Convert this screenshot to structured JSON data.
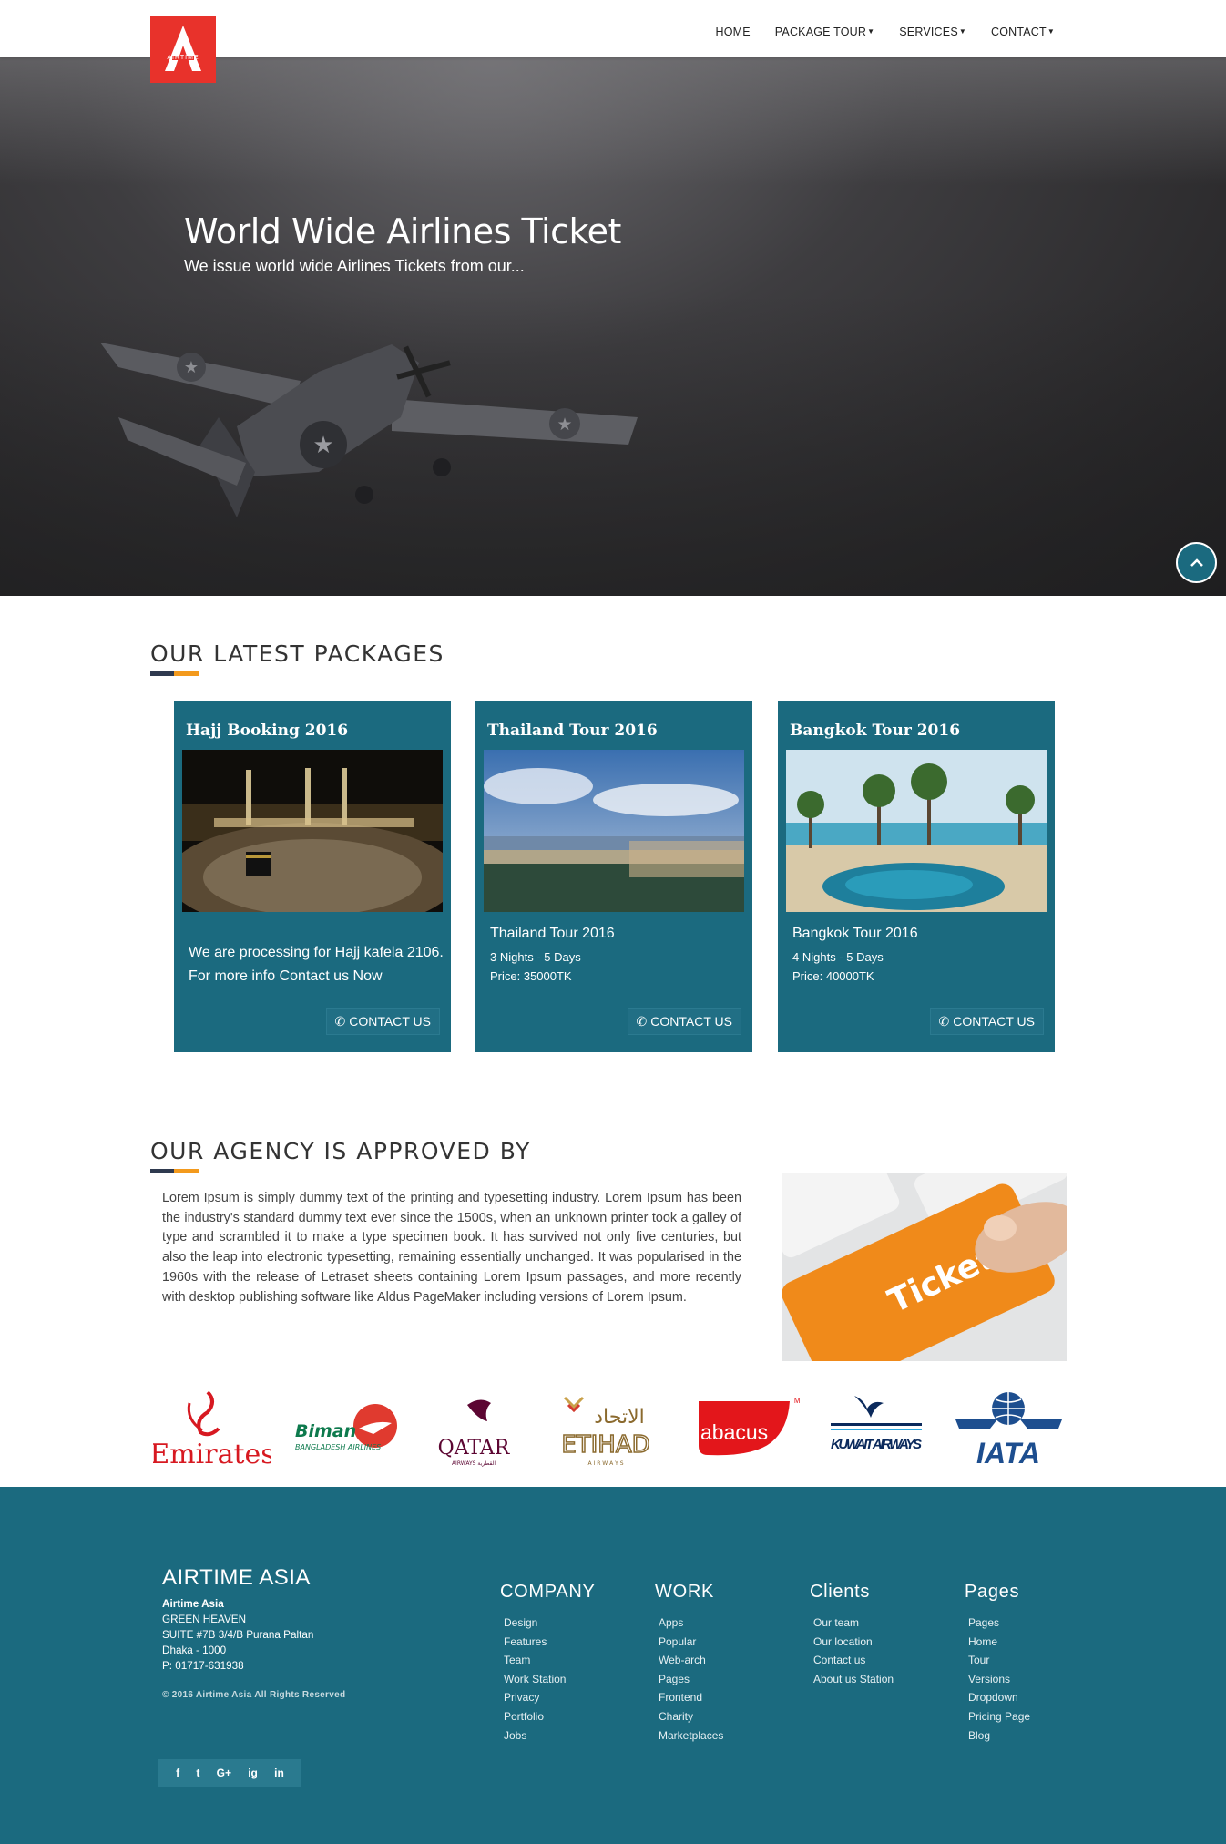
{
  "nav": {
    "brand": "AIRTIME",
    "items": [
      {
        "label": "HOME",
        "dropdown": false
      },
      {
        "label": "PACKAGE TOUR",
        "dropdown": true
      },
      {
        "label": "SERVICES",
        "dropdown": true
      },
      {
        "label": "CONTACT",
        "dropdown": true
      }
    ]
  },
  "hero": {
    "title": "World Wide Airlines Ticket",
    "subtitle": "We issue world wide Airlines Tickets from our..."
  },
  "packages_section": {
    "title": "OUR LATEST PACKAGES",
    "cards": [
      {
        "title": "Hajj Booking 2016",
        "text_line1": "We are processing for Hajj kafela 2106.",
        "text_line2": "For more info Contact us Now",
        "button": "CONTACT US"
      },
      {
        "title": "Thailand Tour 2016",
        "name": "Thailand Tour 2016",
        "duration": "3 Nights - 5 Days",
        "price": "Price: 35000TK",
        "button": "CONTACT US"
      },
      {
        "title": "Bangkok Tour 2016",
        "name": "Bangkok Tour 2016",
        "duration": "4 Nights - 5 Days",
        "price": "Price: 40000TK",
        "button": "CONTACT US"
      }
    ]
  },
  "approved_section": {
    "title": "OUR AGENCY IS APPROVED BY",
    "body": "Lorem Ipsum is simply dummy text of the printing and typesetting industry. Lorem Ipsum has been the industry's standard dummy text ever since the 1500s, when an unknown printer took a galley of type and scrambled it to make a type specimen book. It has survived not only five centuries, but also the leap into electronic typesetting, remaining essentially unchanged. It was popularised in the 1960s with the release of Letraset sheets containing Lorem Ipsum passages, and more recently with desktop publishing software like Aldus PageMaker including versions of Lorem Ipsum.",
    "image_label": "Ticket"
  },
  "partner_logos": [
    {
      "name": "Emirates",
      "color": "#d71921"
    },
    {
      "name": "Biman",
      "sub": "BANGLADESH AIRLINES",
      "color": "#e03a2f"
    },
    {
      "name": "QATAR",
      "sub": "AIRWAYS القطرية",
      "color": "#5c0632"
    },
    {
      "name": "ETIHAD",
      "sub": "A I R W A Y S",
      "arabic": "الاتحاد",
      "color": "#8b6a2e"
    },
    {
      "name": "abacus",
      "tm": "TM",
      "color": "#e3161b"
    },
    {
      "name": "KUWAIT AIRWAYS",
      "color": "#0b2a5c"
    },
    {
      "name": "IATA",
      "color": "#1d4e8f"
    }
  ],
  "footer": {
    "brand": "AIRTIME ASIA",
    "address": {
      "company": "Airtime Asia",
      "line1": "GREEN HEAVEN",
      "line2": "SUITE #7B 3/4/B Purana Paltan",
      "line3": "Dhaka - 1000",
      "phone": "P: 01717-631938"
    },
    "copyright": "© 2016 Airtime Asia All Rights Reserved",
    "columns": [
      {
        "title": "COMPANY",
        "links": [
          "Design",
          "Features",
          "Team",
          "Work Station",
          "Privacy",
          "Portfolio",
          "Jobs"
        ]
      },
      {
        "title": "WORK",
        "links": [
          "Apps",
          "Popular",
          "Web-arch",
          "Pages",
          "Frontend",
          "Charity",
          "Marketplaces"
        ]
      },
      {
        "title": "Clients",
        "links": [
          "Our team",
          "Our location",
          "Contact us",
          "About us Station"
        ]
      },
      {
        "title": "Pages",
        "links": [
          "Pages",
          "Home",
          "Tour",
          "Versions",
          "Dropdown",
          "Pricing Page",
          "Blog"
        ]
      }
    ],
    "social": [
      "f",
      "t",
      "G+",
      "ig",
      "in"
    ]
  },
  "colors": {
    "teal": "#1b6a7f",
    "accent_orange": "#f39a1d",
    "accent_navy": "#2f3a4f",
    "logo_red": "#e8322b"
  }
}
